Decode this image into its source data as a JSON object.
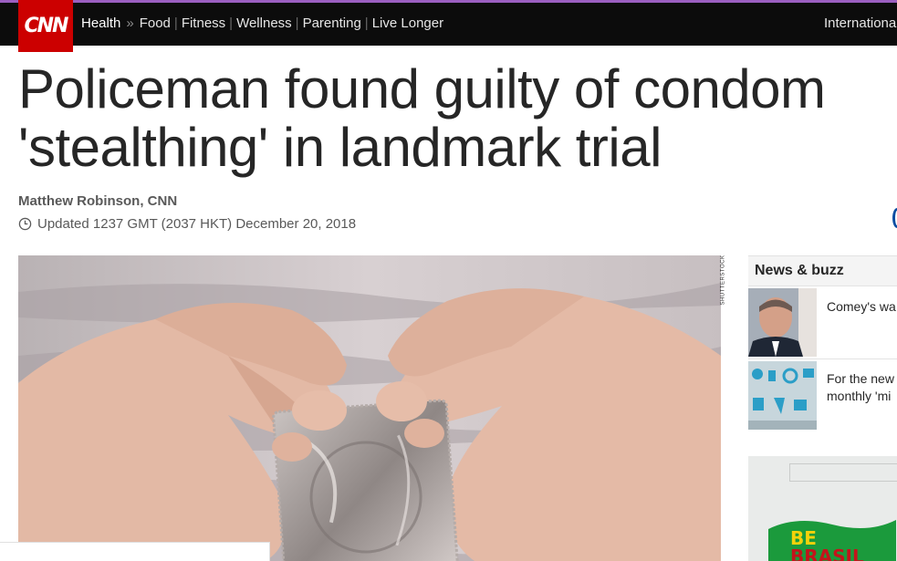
{
  "nav": {
    "logo": "CNN",
    "section": "Health",
    "separator": "»",
    "links": [
      "Food",
      "Fitness",
      "Wellness",
      "Parenting",
      "Live Longer"
    ],
    "edition": "International"
  },
  "article": {
    "headline_line1": "Policeman found guilty of condom",
    "headline_line2": "'stealthing' in landmark trial",
    "byline": "Matthew Robinson, CNN",
    "updated": "Updated 1237 GMT (2037 HKT) December 20, 2018",
    "image_credit": "SHUTTERSTOCK"
  },
  "rail": {
    "heading": "News & buzz",
    "items": [
      {
        "text": "Comey's wa",
        "thumb_icon": "portrait-photo"
      },
      {
        "text": "For the new monthly 'mi",
        "thumb_icon": "illustration-photo"
      }
    ],
    "ad": {
      "line1": "BE",
      "line2": "BRASIL"
    }
  },
  "colors": {
    "brand_red": "#cc0000",
    "nav_bg": "#0c0c0c",
    "accent_purple": "#9b5fc0"
  }
}
